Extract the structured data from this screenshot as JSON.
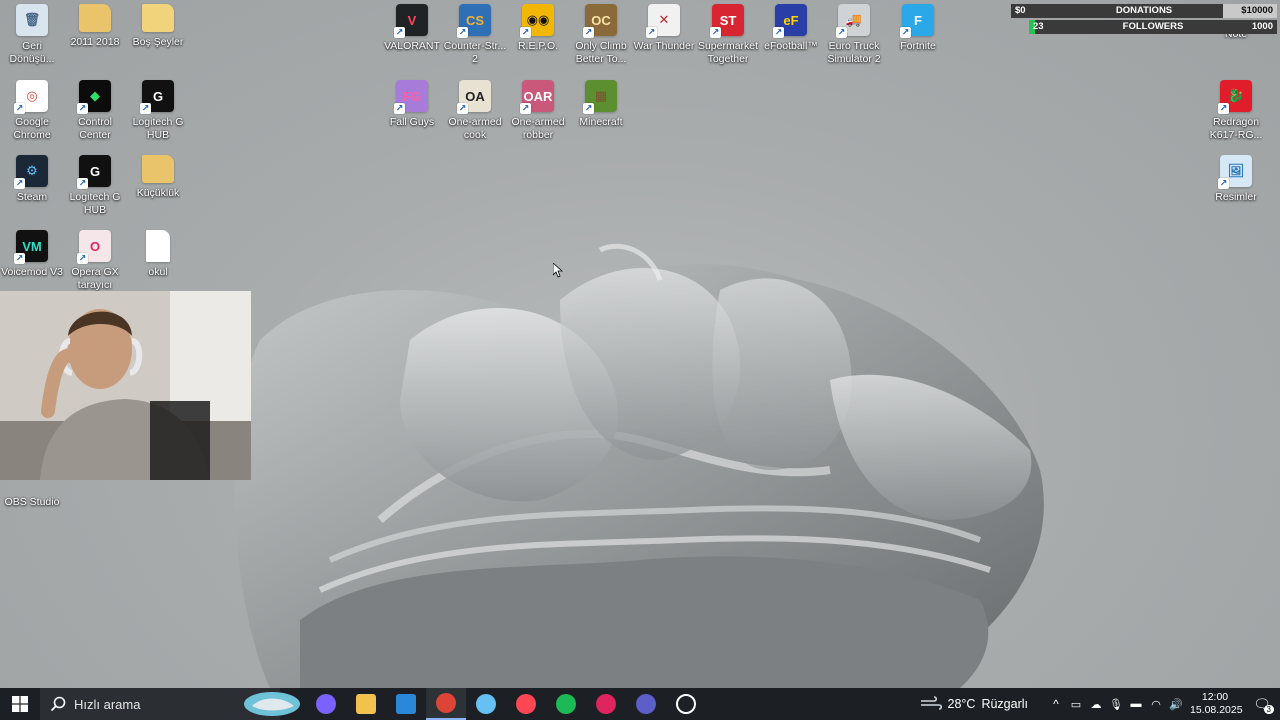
{
  "desktop_icons": [
    {
      "id": "recycle",
      "label": "Geri Dönüşü...",
      "glyph": "recycle-bin-icon",
      "color": "#d8e4ee",
      "fg": "#4a6b8a",
      "text": "🗑",
      "shortcut": false
    },
    {
      "id": "folder2011",
      "label": "2011 2018",
      "glyph": "folder-icon",
      "color": "#e9c46a",
      "fg": "#6b4f12",
      "text": "",
      "shortcut": false
    },
    {
      "id": "bossey",
      "label": "Boş Şeyler",
      "glyph": "folder-icon",
      "color": "#f0d37a",
      "fg": "#6b4f12",
      "text": "",
      "shortcut": false
    },
    {
      "id": "valorant",
      "label": "VALORANT",
      "glyph": "valorant-icon",
      "color": "#1f2326",
      "fg": "#ff4655",
      "text": "V",
      "shortcut": true
    },
    {
      "id": "cs2",
      "label": "Counter-Str... 2",
      "glyph": "counter-strike-icon",
      "color": "#2f6fb5",
      "fg": "#f4b331",
      "text": "CS",
      "shortcut": true
    },
    {
      "id": "repo",
      "label": "R.E.P.O.",
      "glyph": "repo-icon",
      "color": "#f2b705",
      "fg": "#111",
      "text": "◉◉",
      "shortcut": true
    },
    {
      "id": "onlyclimb",
      "label": "Only Climb Better To...",
      "glyph": "only-climb-icon",
      "color": "#8b6a3a",
      "fg": "#f7e3a3",
      "text": "OC",
      "shortcut": true
    },
    {
      "id": "warthunder",
      "label": "War Thunder",
      "glyph": "war-thunder-icon",
      "color": "#f1f1f1",
      "fg": "#c0262d",
      "text": "✕",
      "shortcut": true
    },
    {
      "id": "supermarket",
      "label": "Supermarket Together",
      "glyph": "supermarket-icon",
      "color": "#d72631",
      "fg": "#fff",
      "text": "ST",
      "shortcut": true
    },
    {
      "id": "efootball",
      "label": "eFootball™",
      "glyph": "efootball-icon",
      "color": "#2a3ea8",
      "fg": "#ffd400",
      "text": "eF",
      "shortcut": true
    },
    {
      "id": "ets2",
      "label": "Euro Truck Simulator 2",
      "glyph": "truck-icon",
      "color": "#cfd3d6",
      "fg": "#333",
      "text": "🚚",
      "shortcut": true
    },
    {
      "id": "fortnite",
      "label": "Fortnite",
      "glyph": "fortnite-icon",
      "color": "#2aa8e8",
      "fg": "#fff",
      "text": "F",
      "shortcut": true
    },
    {
      "id": "chrome",
      "label": "Google Chrome",
      "glyph": "chrome-icon",
      "color": "#ffffff",
      "fg": "#db4437",
      "text": "◎",
      "shortcut": true
    },
    {
      "id": "nvidia",
      "label": "Control Center",
      "glyph": "control-center-icon",
      "color": "#0c0c0c",
      "fg": "#2ee06b",
      "text": "◆",
      "shortcut": true
    },
    {
      "id": "lghub1",
      "label": "Logitech G HUB",
      "glyph": "logitech-icon",
      "color": "#111",
      "fg": "#fff",
      "text": "G",
      "shortcut": true
    },
    {
      "id": "fallguys",
      "label": "Fall Guys",
      "glyph": "fall-guys-icon",
      "color": "#a77bd9",
      "fg": "#ff5fa2",
      "text": "FG",
      "shortcut": true
    },
    {
      "id": "cook",
      "label": "One-armed cook",
      "glyph": "one-armed-cook-icon",
      "color": "#e8e2d3",
      "fg": "#222",
      "text": "OA",
      "shortcut": true
    },
    {
      "id": "robber",
      "label": "One-armed robber",
      "glyph": "one-armed-robber-icon",
      "color": "#c9587a",
      "fg": "#fff",
      "text": "OAR",
      "shortcut": true
    },
    {
      "id": "minecraft",
      "label": "Minecraft",
      "glyph": "minecraft-icon",
      "color": "#5c8f2f",
      "fg": "#7a5230",
      "text": "▦",
      "shortcut": true
    },
    {
      "id": "redragon",
      "label": "Redragon K617-RG...",
      "glyph": "redragon-icon",
      "color": "#e11d2b",
      "fg": "#fff",
      "text": "🐉",
      "shortcut": true
    },
    {
      "id": "steam",
      "label": "Steam",
      "glyph": "steam-icon",
      "color": "#1b2838",
      "fg": "#66c0f4",
      "text": "⚙",
      "shortcut": true
    },
    {
      "id": "lghub2",
      "label": "Logitech G HUB",
      "glyph": "logitech-icon",
      "color": "#111",
      "fg": "#fff",
      "text": "G",
      "shortcut": true
    },
    {
      "id": "kucukluk",
      "label": "Küçüklük",
      "glyph": "folder-icon",
      "color": "#e9c46a",
      "fg": "#6b4f12",
      "text": "",
      "shortcut": false
    },
    {
      "id": "resimler",
      "label": "Resimler",
      "glyph": "pictures-shortcut-icon",
      "color": "#d6e7f5",
      "fg": "#2a7ab8",
      "text": "🖼",
      "shortcut": true
    },
    {
      "id": "voicemod",
      "label": "Voicemod V3",
      "glyph": "voicemod-icon",
      "color": "#111",
      "fg": "#2ee0c5",
      "text": "VM",
      "shortcut": true
    },
    {
      "id": "operagx",
      "label": "Opera GX tarayıcı",
      "glyph": "opera-gx-icon",
      "color": "#f5e6ea",
      "fg": "#e0245e",
      "text": "O",
      "shortcut": true
    },
    {
      "id": "okul",
      "label": "okul",
      "glyph": "file-icon",
      "color": "#ffffff",
      "fg": "#999",
      "text": "",
      "shortcut": false
    },
    {
      "id": "obs",
      "label": "OBS Studio",
      "glyph": "obs-icon",
      "color": "#2b2b2b",
      "fg": "#fff",
      "text": "●",
      "shortcut": true
    },
    {
      "id": "note",
      "label": "Note",
      "glyph": "note-icon",
      "color": "transparent",
      "fg": "#fff",
      "text": "",
      "shortcut": false
    }
  ],
  "stream_widget": {
    "donations": {
      "current": "$0",
      "label": "DONATIONS",
      "goal": "$10000",
      "progress": 0
    },
    "followers": {
      "current": "23",
      "label": "FOLLOWERS",
      "goal": "1000",
      "progress": 0.023
    }
  },
  "taskbar": {
    "search_placeholder": "Hızlı arama",
    "apps": [
      {
        "name": "copilot-icon",
        "color": "#7b61ff"
      },
      {
        "name": "file-explorer-icon",
        "color": "#f2c14e"
      },
      {
        "name": "store-icon",
        "color": "#2b88d8"
      },
      {
        "name": "chrome-icon",
        "color": "#db4437",
        "active": true
      },
      {
        "name": "steam-icon",
        "color": "#66c0f4"
      },
      {
        "name": "valorant-icon",
        "color": "#ff4655"
      },
      {
        "name": "spotify-icon",
        "color": "#1db954"
      },
      {
        "name": "opera-gx-icon",
        "color": "#e0245e"
      },
      {
        "name": "teams-icon",
        "color": "#5b5fc7"
      },
      {
        "name": "obs-icon",
        "color": "#ffffff"
      }
    ],
    "weather": {
      "temp": "28°C",
      "condition": "Rüzgarlı"
    },
    "clock": {
      "time": "12:00",
      "date": "15.08.2025"
    },
    "notifications_count": "3"
  }
}
